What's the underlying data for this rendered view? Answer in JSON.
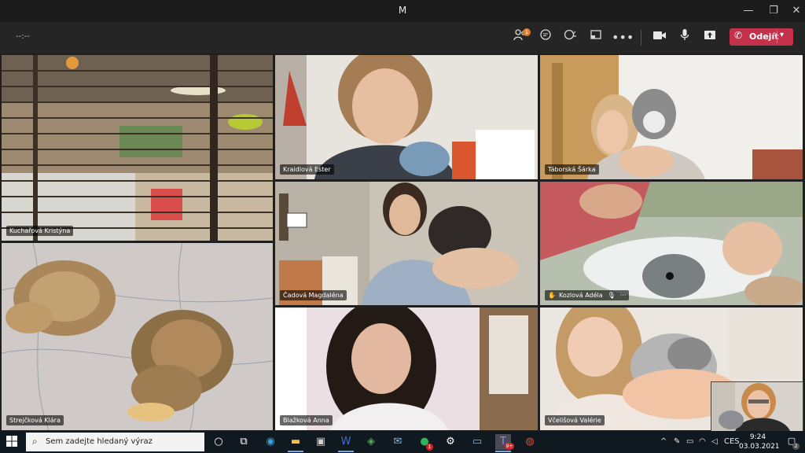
{
  "window": {
    "title": "M",
    "controls": {
      "minimize": "—",
      "maximize": "❐",
      "close": "✕"
    }
  },
  "meeting": {
    "timer": "--:--",
    "participants_badge": "1",
    "leave_label": "Odejít"
  },
  "participants": [
    {
      "name": "Kuchařová Kristýna"
    },
    {
      "name": "Kraidlová Ester"
    },
    {
      "name": "Táborská Šárka"
    },
    {
      "name": "Čadová Magdaléna"
    },
    {
      "name": "Kozlová Adéla",
      "hand_raised": true
    },
    {
      "name": "Strejčková Klára"
    },
    {
      "name": "Blažková Anna"
    },
    {
      "name": "Včelišová Valérie"
    }
  ],
  "taskbar": {
    "search_placeholder": "Sem zadejte hledaný výraz",
    "teams_badge": "9+",
    "whatsapp_badge": "1",
    "language": "CES",
    "time": "9:24",
    "date": "03.03.2021",
    "notification_count": "2"
  }
}
